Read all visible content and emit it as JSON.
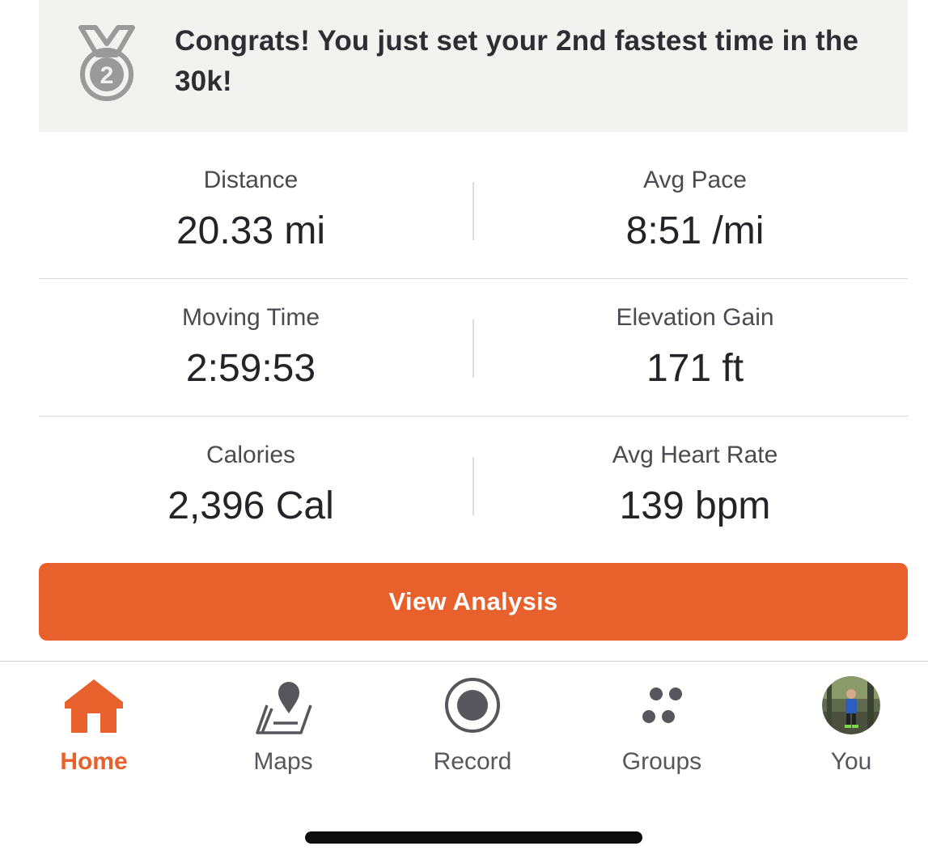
{
  "achievement": {
    "message": "Congrats! You just set your 2nd fastest time in the 30k!",
    "medal_rank": "2",
    "icon": "silver-medal-icon"
  },
  "stats": [
    {
      "label": "Distance",
      "value": "20.33 mi"
    },
    {
      "label": "Avg Pace",
      "value": "8:51 /mi"
    },
    {
      "label": "Moving Time",
      "value": "2:59:53"
    },
    {
      "label": "Elevation Gain",
      "value": "171 ft"
    },
    {
      "label": "Calories",
      "value": "2,396 Cal"
    },
    {
      "label": "Avg Heart Rate",
      "value": "139 bpm"
    }
  ],
  "cta": {
    "label": "View Analysis",
    "color": "#e8612c"
  },
  "tabbar": {
    "active": "Home",
    "items": [
      {
        "label": "Home",
        "icon": "home-icon"
      },
      {
        "label": "Maps",
        "icon": "map-pin-icon"
      },
      {
        "label": "Record",
        "icon": "record-icon"
      },
      {
        "label": "Groups",
        "icon": "groups-icon"
      },
      {
        "label": "You",
        "icon": "avatar"
      }
    ]
  },
  "colors": {
    "accent": "#e8612c",
    "banner_bg": "#f2f2f1",
    "text": "#2d2d32"
  }
}
